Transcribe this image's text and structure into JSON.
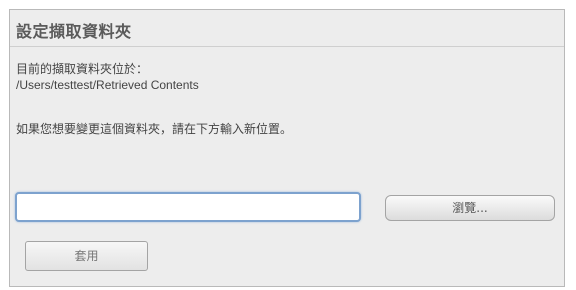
{
  "panel": {
    "title": "設定擷取資料夾",
    "current_label": "目前的擷取資料夾位於：",
    "current_path": "/Users/testtest/Retrieved Contents",
    "instruction": "如果您想要變更這個資料夾，請在下方輸入新位置。",
    "path_input": {
      "value": "",
      "placeholder": ""
    },
    "browse_label": "瀏覽...",
    "apply_label": "套用"
  }
}
